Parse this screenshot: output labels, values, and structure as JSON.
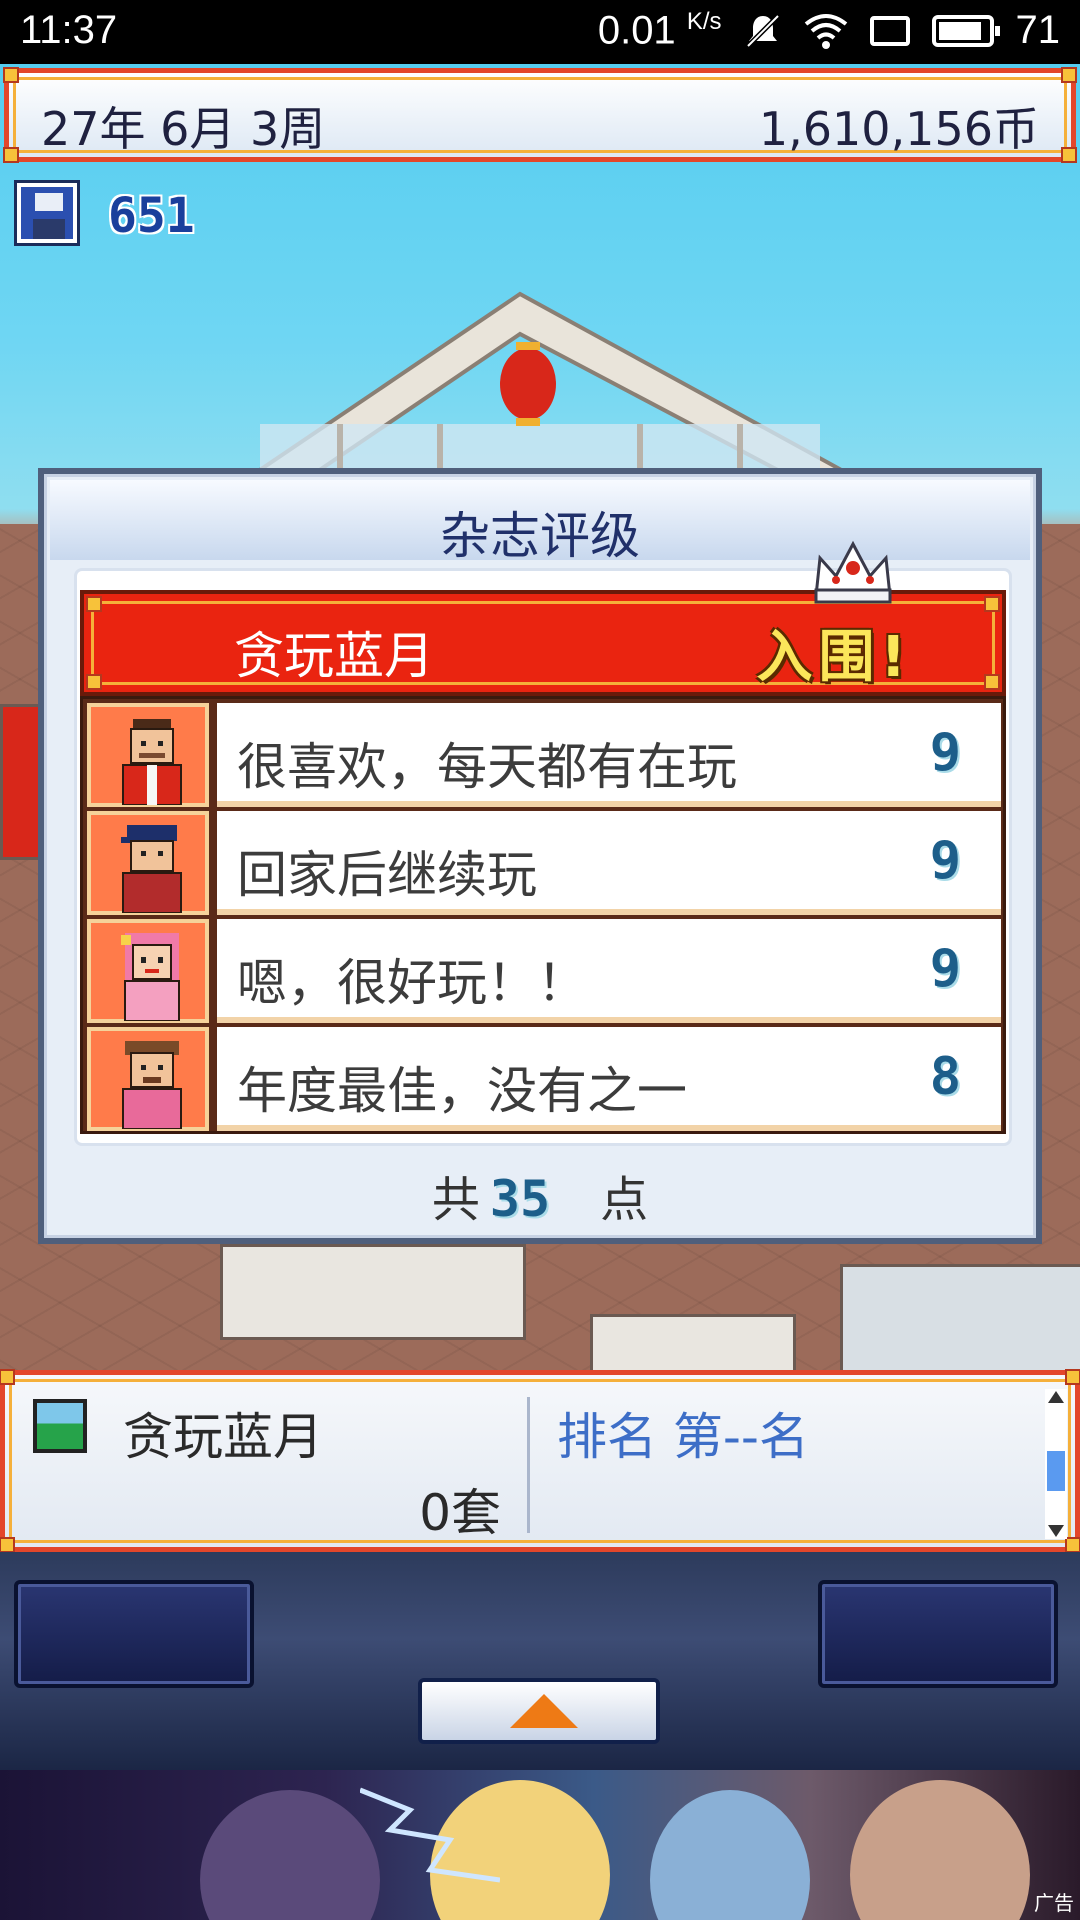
{
  "status_bar": {
    "time": "11:37",
    "network_speed": "0.01",
    "network_unit": "K/s",
    "battery": "71"
  },
  "top_bar": {
    "date": "27年 6月 3周",
    "money": "1,610,156币"
  },
  "save": {
    "count": "651"
  },
  "dialog": {
    "title": "杂志评级",
    "game_name": "贪玩蓝月",
    "badge": "入围!",
    "reviews": [
      {
        "text": "很喜欢，每天都有在玩",
        "score": "9",
        "reviewer": "man-red-jacket"
      },
      {
        "text": "回家后继续玩",
        "score": "9",
        "reviewer": "man-blue-cap"
      },
      {
        "text": "嗯，很好玩！！",
        "score": "9",
        "reviewer": "woman-pink-hair"
      },
      {
        "text": "年度最佳，没有之一",
        "score": "8",
        "reviewer": "man-brown-hat"
      }
    ],
    "total_prefix": "共",
    "total_points": "35",
    "total_unit": "点"
  },
  "info_bar": {
    "game_name": "贪玩蓝月",
    "sets": "0套",
    "rank": "排名 第--名"
  },
  "ad": {
    "label": "广告"
  },
  "colors": {
    "accent_red": "#ea2410",
    "frame_gold": "#f5b03a",
    "score_blue": "#1d5e8a",
    "rank_blue": "#3d6ec7"
  }
}
